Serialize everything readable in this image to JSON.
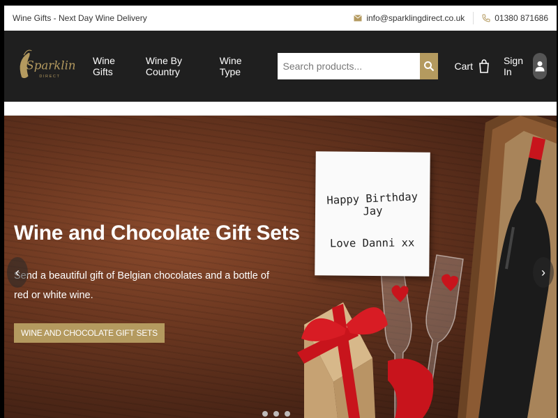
{
  "topbar": {
    "tagline": "Wine Gifts - Next Day Wine Delivery",
    "email": "info@sparklingdirect.co.uk",
    "phone": "01380 871686"
  },
  "nav": {
    "logo_text": "Sparkling",
    "logo_sub": "DIRECT",
    "links": [
      "Wine Gifts",
      "Wine By Country",
      "Wine Type"
    ],
    "search_placeholder": "Search products...",
    "cart_label": "Cart",
    "signin_label": "Sign In"
  },
  "hero": {
    "title": "Wine and Chocolate Gift Sets",
    "description": "Send a beautiful gift of Belgian chocolates and a bottle of red or white wine.",
    "cta_label": "WINE AND CHOCOLATE GIFT SETS",
    "card_line1": "Happy Birthday Jay",
    "card_line2": "Love Danni xx",
    "prev_label": "‹",
    "next_label": "›"
  },
  "colors": {
    "accent": "#b49a5f",
    "nav_bg": "#1f1f1f",
    "wine_red": "#c8141c"
  },
  "icons": [
    "envelope-icon",
    "phone-icon",
    "search-icon",
    "shopping-bag-icon",
    "user-icon"
  ]
}
